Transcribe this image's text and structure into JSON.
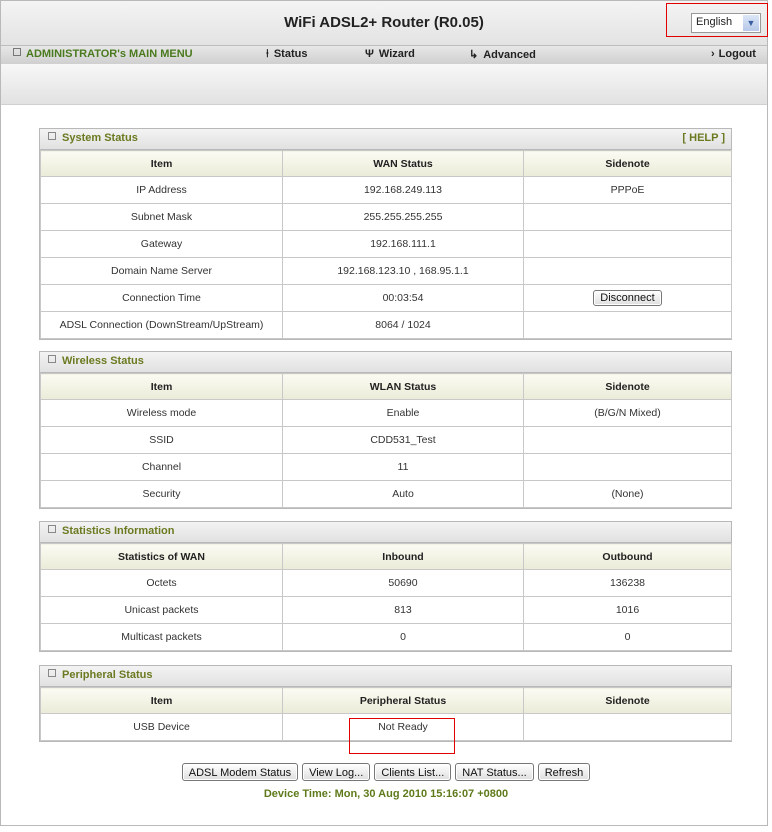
{
  "header": {
    "title": "WiFi ADSL2+ Router   (R0.05)",
    "language": "English"
  },
  "menu": {
    "admin": "ADMINISTRATOR's MAIN MENU",
    "status": "Status",
    "wizard": "Wizard",
    "advanced": "Advanced",
    "logout": "Logout"
  },
  "system": {
    "title": "System Status",
    "help": "[ HELP ]",
    "headers": [
      "Item",
      "WAN Status",
      "Sidenote"
    ],
    "rows": [
      [
        "IP Address",
        "192.168.249.113",
        "PPPoE"
      ],
      [
        "Subnet Mask",
        "255.255.255.255",
        ""
      ],
      [
        "Gateway",
        "192.168.111.1",
        ""
      ],
      [
        "Domain Name Server",
        "192.168.123.10 , 168.95.1.1",
        ""
      ],
      [
        "Connection Time",
        "00:03:54",
        ""
      ],
      [
        "ADSL Connection (DownStream/UpStream)",
        "8064 / 1024",
        ""
      ]
    ],
    "disconnect": "Disconnect"
  },
  "wireless": {
    "title": "Wireless Status",
    "headers": [
      "Item",
      "WLAN Status",
      "Sidenote"
    ],
    "rows": [
      [
        "Wireless mode",
        "Enable",
        "(B/G/N Mixed)"
      ],
      [
        "SSID",
        "CDD531_Test",
        ""
      ],
      [
        "Channel",
        "11",
        ""
      ],
      [
        "Security",
        "Auto",
        "(None)"
      ]
    ]
  },
  "statistics": {
    "title": "Statistics Information",
    "headers": [
      "Statistics of WAN",
      "Inbound",
      "Outbound"
    ],
    "rows": [
      [
        "Octets",
        "50690",
        "136238"
      ],
      [
        "Unicast packets",
        "813",
        "1016"
      ],
      [
        "Multicast packets",
        "0",
        "0"
      ]
    ]
  },
  "peripheral": {
    "title": "Peripheral Status",
    "headers": [
      "Item",
      "Peripheral Status",
      "Sidenote"
    ],
    "rows": [
      [
        "USB Device",
        "Not Ready",
        ""
      ]
    ]
  },
  "buttons": {
    "modem": "ADSL Modem Status",
    "log": "View Log...",
    "clients": "Clients List...",
    "nat": "NAT Status...",
    "refresh": "Refresh"
  },
  "device_time": "Device Time: Mon, 30 Aug 2010 15:16:07 +0800"
}
